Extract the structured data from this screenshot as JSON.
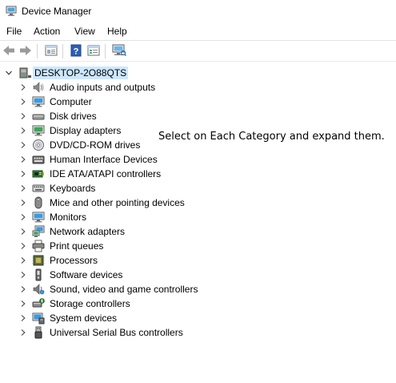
{
  "window": {
    "title": "Device Manager"
  },
  "menu": [
    "File",
    "Action",
    "View",
    "Help"
  ],
  "toolbar": {
    "buttons": [
      "back-icon",
      "forward-icon",
      "properties-icon",
      "help-icon",
      "view-icon",
      "scan-hardware-icon"
    ]
  },
  "tree": {
    "root": "DESKTOP-2O88QTS",
    "items": [
      {
        "label": "Audio inputs and outputs",
        "icon": "speaker-icon"
      },
      {
        "label": "Computer",
        "icon": "computer-icon"
      },
      {
        "label": "Disk drives",
        "icon": "disk-drive-icon"
      },
      {
        "label": "Display adapters",
        "icon": "display-adapter-icon"
      },
      {
        "label": "DVD/CD-ROM drives",
        "icon": "dvd-drive-icon"
      },
      {
        "label": "Human Interface Devices",
        "icon": "hid-icon"
      },
      {
        "label": "IDE ATA/ATAPI controllers",
        "icon": "ide-controller-icon"
      },
      {
        "label": "Keyboards",
        "icon": "keyboard-icon"
      },
      {
        "label": "Mice and other pointing devices",
        "icon": "mouse-icon"
      },
      {
        "label": "Monitors",
        "icon": "monitor-icon"
      },
      {
        "label": "Network adapters",
        "icon": "network-adapter-icon"
      },
      {
        "label": "Print queues",
        "icon": "printer-icon"
      },
      {
        "label": "Processors",
        "icon": "processor-icon"
      },
      {
        "label": "Software devices",
        "icon": "software-device-icon"
      },
      {
        "label": "Sound, video and game controllers",
        "icon": "sound-controller-icon"
      },
      {
        "label": "Storage controllers",
        "icon": "storage-controller-icon"
      },
      {
        "label": "System devices",
        "icon": "system-devices-icon"
      },
      {
        "label": "Universal Serial Bus controllers",
        "icon": "usb-icon"
      }
    ]
  },
  "annotation": "Select on Each Category and expand them.",
  "colors": {
    "selection": "#cce8ff",
    "accent": "#1f78d1"
  }
}
